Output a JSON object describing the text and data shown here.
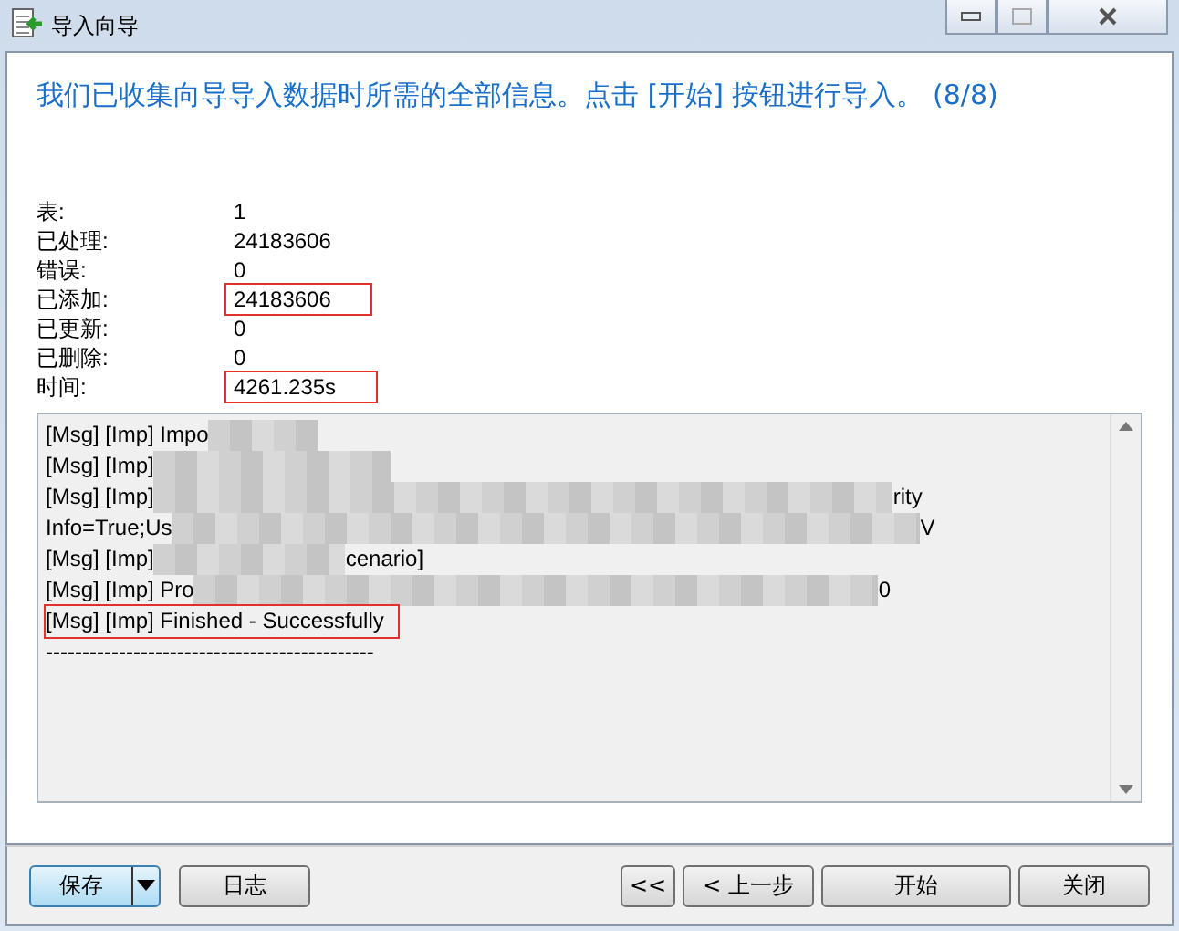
{
  "window": {
    "title": "导入向导"
  },
  "heading": "我们已收集向导导入数据时所需的全部信息。点击 [开始] 按钮进行导入。 (8/8)",
  "stats": [
    {
      "label": "表:",
      "value": "1",
      "highlighted": false
    },
    {
      "label": "已处理:",
      "value": "24183606",
      "highlighted": false
    },
    {
      "label": "错误:",
      "value": "0",
      "highlighted": false
    },
    {
      "label": "已添加:",
      "value": "24183606",
      "highlighted": true
    },
    {
      "label": "已更新:",
      "value": "0",
      "highlighted": false
    },
    {
      "label": "已删除:",
      "value": "0",
      "highlighted": false
    },
    {
      "label": "时间:",
      "value": "4261.235s",
      "highlighted": true
    }
  ],
  "log": [
    {
      "segments": [
        "[Msg] [Imp] Impo"
      ],
      "highlighted": false
    },
    {
      "segments": [
        "[Msg] [Imp]"
      ],
      "highlighted": false
    },
    {
      "segments": [
        "[Msg] [Imp]",
        "rity"
      ],
      "highlighted": false
    },
    {
      "segments": [
        "Info=True;Us",
        "V"
      ],
      "highlighted": false
    },
    {
      "segments": [
        "[Msg] [Imp]",
        "cenario]"
      ],
      "highlighted": false
    },
    {
      "segments": [
        "[Msg] [Imp] Pro",
        "0"
      ],
      "highlighted": false
    },
    {
      "segments": [
        "[Msg] [Imp] Finished - Successfully"
      ],
      "highlighted": true
    },
    {
      "segments": [
        "---------------------------------------------"
      ],
      "highlighted": false
    }
  ],
  "buttons_left": [
    {
      "label": "保存",
      "kind": "split"
    },
    {
      "label": "日志",
      "kind": "plain"
    }
  ],
  "buttons_right": [
    {
      "label": "<<",
      "kind": "plain"
    },
    {
      "label": "< 上一步",
      "kind": "plain"
    },
    {
      "label": "开始",
      "kind": "plain"
    },
    {
      "label": "关闭",
      "kind": "plain"
    }
  ]
}
